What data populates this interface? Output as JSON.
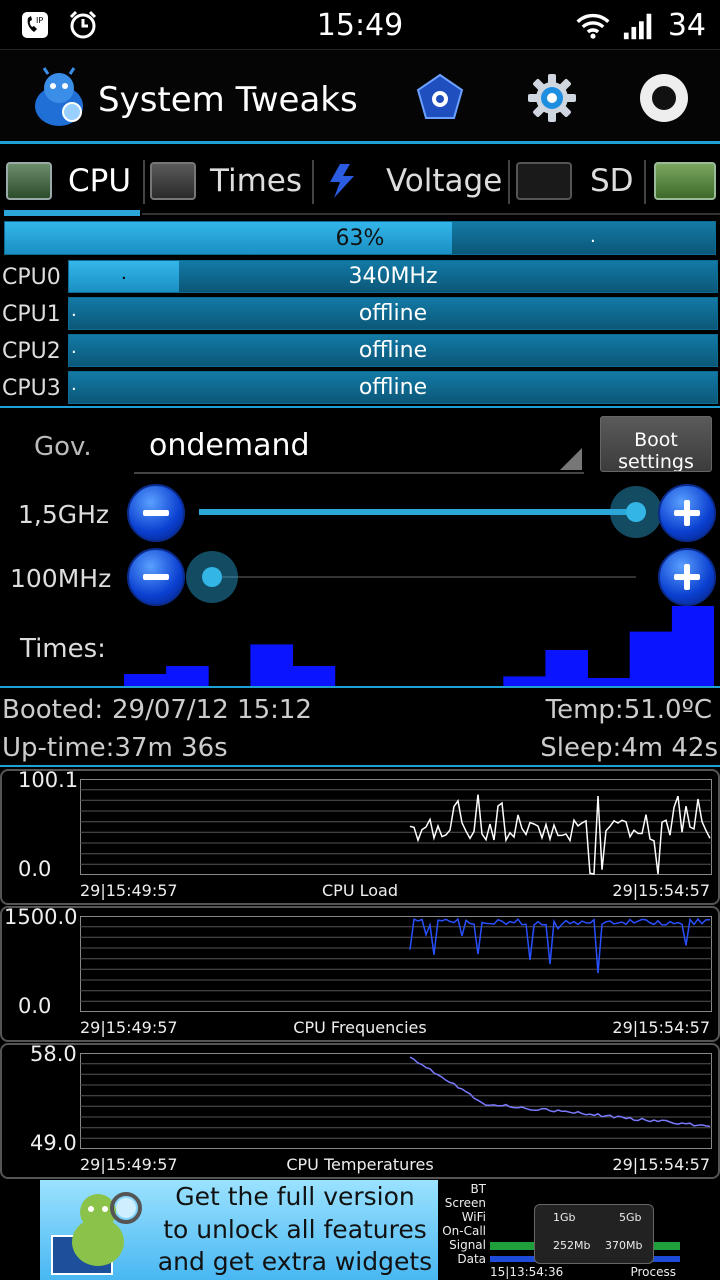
{
  "status_bar": {
    "time": "15:49",
    "battery": "34"
  },
  "app": {
    "title": "System Tweaks"
  },
  "tabs": [
    {
      "label": "CPU",
      "active": true
    },
    {
      "label": "Times",
      "active": false
    },
    {
      "label": "Voltage",
      "active": false
    },
    {
      "label": "SD",
      "active": false
    }
  ],
  "total_load": {
    "label": "63%",
    "value": 0.63,
    "dot": "."
  },
  "cpus": [
    {
      "name": "CPU0",
      "status": "340MHz",
      "fill": 0.17,
      "dot": "."
    },
    {
      "name": "CPU1",
      "status": "offline",
      "fill": 0.0,
      "dot": "."
    },
    {
      "name": "CPU2",
      "status": "offline",
      "fill": 0.0,
      "dot": "."
    },
    {
      "name": "CPU3",
      "status": "offline",
      "fill": 0.0,
      "dot": "."
    }
  ],
  "governor": {
    "label": "Gov.",
    "value": "ondemand",
    "boot_button": "Boot settings"
  },
  "max_freq": {
    "label": "1,5GHz",
    "level": 1.0
  },
  "min_freq": {
    "label": "100MHz",
    "level": 0.0
  },
  "times": {
    "label": "Times:",
    "bins": [
      0.15,
      0.25,
      0,
      0.52,
      0.25,
      0,
      0,
      0,
      0,
      0.12,
      0.45,
      0.1,
      0.68,
      1.0
    ]
  },
  "info": {
    "booted_label": "Booted:",
    "booted_value": "29/07/12 15:12",
    "uptime": "Up-time:37m 36s",
    "temp": "Temp:51.0ºC",
    "sleep": "Sleep:4m 42s"
  },
  "graphs": [
    {
      "title": "CPU Load",
      "ymax": "100.1",
      "ymin": "0.0",
      "start": "29|15:49:57",
      "end": "29|15:54:57",
      "color": "#ffffff"
    },
    {
      "title": "CPU Frequencies",
      "ymax": "1500.0",
      "ymin": "0.0",
      "start": "29|15:49:57",
      "end": "29|15:54:57",
      "color": "#2850ff"
    },
    {
      "title": "CPU Temperatures",
      "ymax": "58.0",
      "ymin": "49.0",
      "start": "29|15:49:57",
      "end": "29|15:54:57",
      "color": "#7a7aff"
    }
  ],
  "ad": {
    "lines": [
      "Get the full version",
      "to unlock all features",
      "and get extra widgets"
    ],
    "widget_labels": [
      "BT",
      "Screen",
      "WiFi",
      "On-Call",
      "Signal",
      "Data"
    ],
    "widget_values": [
      "1Gb",
      "5Gb",
      "252Mb",
      "370Mb"
    ],
    "widget_time": "15|13:54:36",
    "widget_process": "Process"
  }
}
